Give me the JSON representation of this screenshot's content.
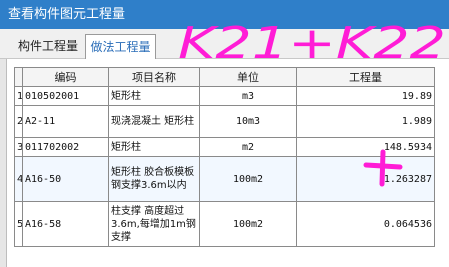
{
  "window": {
    "title": "查看构件图元工程量"
  },
  "tabs": [
    {
      "label": "构件工程量"
    },
    {
      "label": "做法工程量"
    }
  ],
  "table": {
    "headers": [
      "编码",
      "项目名称",
      "单位",
      "工程量"
    ],
    "rows": [
      {
        "index": "1",
        "code": "010502001",
        "name": "矩形柱",
        "unit": "m3",
        "quantity": "19.89"
      },
      {
        "index": "2",
        "code": "A2-11",
        "name": "现浇混凝土 矩形柱",
        "unit": "10m3",
        "quantity": "1.989"
      },
      {
        "index": "3",
        "code": "011702002",
        "name": "矩形柱",
        "unit": "m2",
        "quantity": "148.5934"
      },
      {
        "index": "4",
        "code": "A16-50",
        "name": "矩形柱 胶合板模板 钢支撑3.6m以内",
        "unit": "100m2",
        "quantity": "1.263287"
      },
      {
        "index": "5",
        "code": "A16-58",
        "name": "柱支撑 高度超过3.6m,每增加1m钢支撑",
        "unit": "100m2",
        "quantity": "0.064536"
      }
    ]
  },
  "annotation": {
    "text": "K21+K22",
    "color": "#ff1cd6"
  }
}
